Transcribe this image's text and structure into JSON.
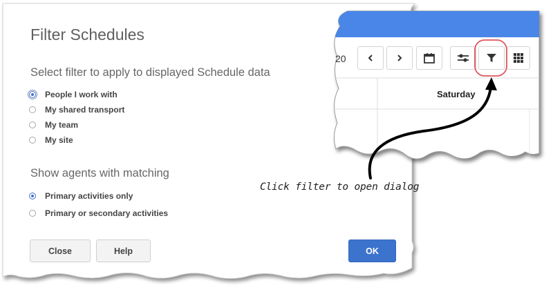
{
  "dialog": {
    "title": "Filter Schedules",
    "filter_section": "Select filter to apply to displayed Schedule data",
    "filter_options": [
      {
        "label": "People I work with",
        "checked": true
      },
      {
        "label": "My shared transport",
        "checked": false
      },
      {
        "label": "My team",
        "checked": false
      },
      {
        "label": "My site",
        "checked": false
      }
    ],
    "match_section": "Show agents with matching",
    "match_options": [
      {
        "label": "Primary activities only",
        "checked": true
      },
      {
        "label": "Primary or secondary activities",
        "checked": false
      }
    ],
    "close_label": "Close",
    "help_label": "Help",
    "ok_label": "OK"
  },
  "inset": {
    "year_fragment": "20",
    "column_header": "Saturday",
    "toolbar_icons": [
      "chevron-left-icon",
      "chevron-right-icon",
      "calendar-icon",
      "sliders-icon",
      "filter-icon",
      "grid-icon"
    ],
    "header_color": "#4a86e8",
    "highlight_color": "#e0565a"
  },
  "annotation": "Click filter to open dialog"
}
